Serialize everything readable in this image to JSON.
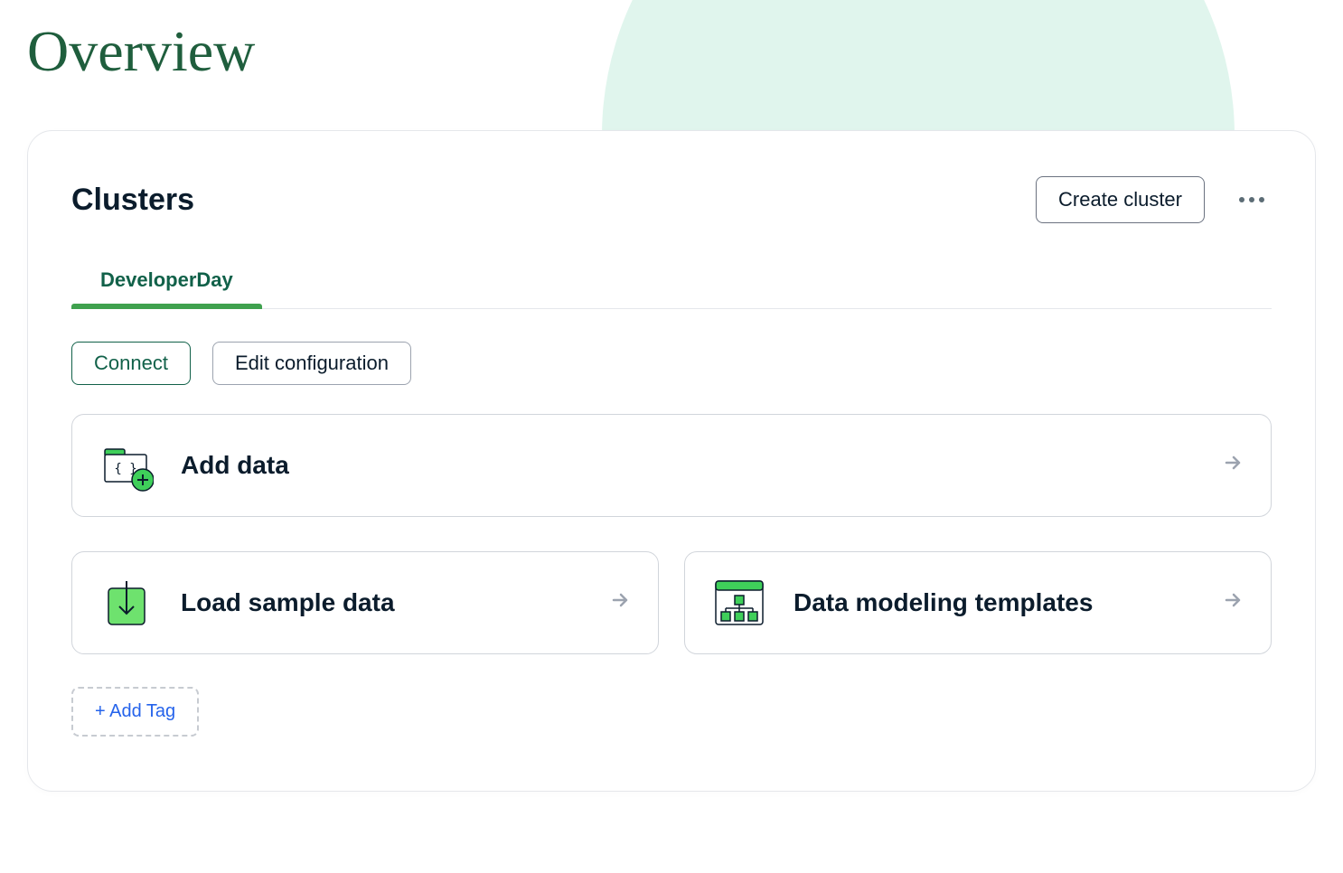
{
  "page": {
    "title": "Overview"
  },
  "clusters_card": {
    "title": "Clusters",
    "create_button": "Create cluster",
    "tabs": [
      {
        "label": "DeveloperDay",
        "active": true
      }
    ],
    "connect_button": "Connect",
    "edit_config_button": "Edit configuration",
    "tiles": {
      "add_data": "Add data",
      "load_sample": "Load sample data",
      "data_modeling": "Data modeling templates"
    },
    "add_tag_button": "+ Add Tag"
  }
}
